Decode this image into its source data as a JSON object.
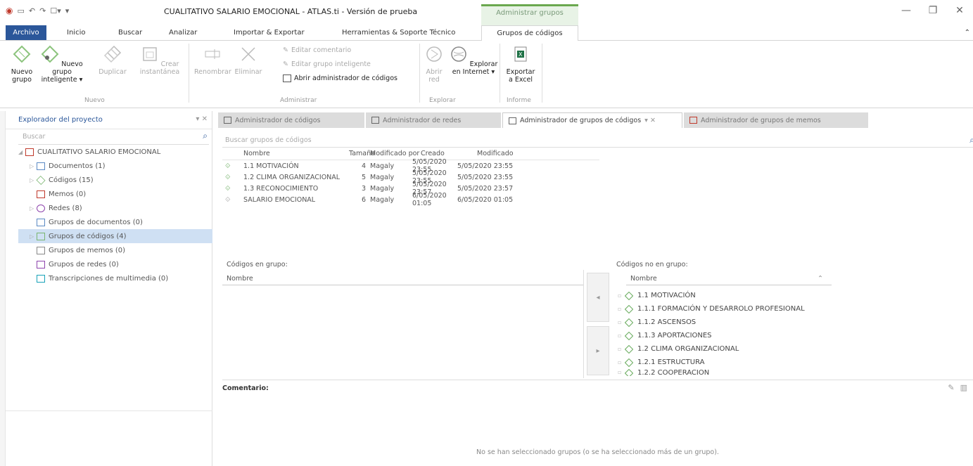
{
  "window": {
    "title": "CUALITATIVO SALARIO EMOCIONAL - ATLAS.ti - Versión de prueba",
    "context_tab": "Administrar grupos"
  },
  "ribbon_tabs": [
    "Archivo",
    "Inicio",
    "Buscar",
    "Analizar",
    "Importar & Exportar",
    "Herramientas & Soporte Técnico",
    "Grupos de códigos"
  ],
  "ribbon": {
    "nuevo_grupo": "Nuevo grupo",
    "nuevo_grupo_int": "Nuevo grupo inteligente ▾",
    "duplicar": "Duplicar",
    "crear_inst": "Crear instantánea",
    "renombrar": "Renombrar",
    "eliminar": "Eliminar",
    "editar_com": "Editar comentario",
    "editar_gi": "Editar grupo inteligente",
    "abrir_admin": "Abrir administrador de códigos",
    "abrir_red": "Abrir red",
    "explorar": "Explorar en Internet ▾",
    "exportar": "Exportar a Excel",
    "g_nuevo": "Nuevo",
    "g_administrar": "Administrar",
    "g_explorar": "Explorar",
    "g_informe": "Informe"
  },
  "explorer": {
    "title": "Explorador del proyecto",
    "search_placeholder": "Buscar",
    "root": "CUALITATIVO SALARIO EMOCIONAL",
    "items": [
      "Documentos (1)",
      "Códigos (15)",
      "Memos (0)",
      "Redes (8)",
      "Grupos de documentos (0)",
      "Grupos de códigos (4)",
      "Grupos de memos (0)",
      "Grupos de redes (0)",
      "Transcripciones de multimedia (0)"
    ]
  },
  "doc_tabs": [
    "Administrador de códigos",
    "Administrador de redes",
    "Administrador de grupos de códigos",
    "Administrador de grupos de memos"
  ],
  "group_search_placeholder": "Buscar grupos de códigos",
  "table": {
    "headers": [
      "Nombre",
      "Tamaño",
      "Modificado por",
      "Creado",
      "Modificado"
    ],
    "rows": [
      [
        "1.1 MOTIVACIÓN",
        "4",
        "Magaly",
        "5/05/2020 23:55",
        "5/05/2020 23:55"
      ],
      [
        "1.2 CLIMA ORGANIZACIONAL",
        "5",
        "Magaly",
        "5/05/2020 23:55",
        "5/05/2020 23:55"
      ],
      [
        "1.3 RECONOCIMIENTO",
        "3",
        "Magaly",
        "5/05/2020 23:57",
        "5/05/2020 23:57"
      ],
      [
        "SALARIO EMOCIONAL",
        "6",
        "Magaly",
        "6/05/2020 01:05",
        "6/05/2020 01:05"
      ]
    ]
  },
  "panes": {
    "in_group": "Códigos en grupo:",
    "not_in_group": "Códigos no en grupo:",
    "col_name": "Nombre",
    "not_in_items": [
      "1.1 MOTIVACIÓN",
      "1.1.1 FORMACIÓN Y DESARROLO PROFESIONAL",
      "1.1.2 ASCENSOS",
      "1.1.3 APORTACIONES",
      "1.2 CLIMA ORGANIZACIONAL",
      "1.2.1 ESTRUCTURA",
      "1.2.2 COOPERACIÓN"
    ]
  },
  "comments": {
    "label": "Comentario:",
    "note": "No se han seleccionado grupos (o se ha seleccionado más de un grupo)."
  },
  "colors": {
    "accent": "#2b579a",
    "code_green": "#7ab570"
  }
}
